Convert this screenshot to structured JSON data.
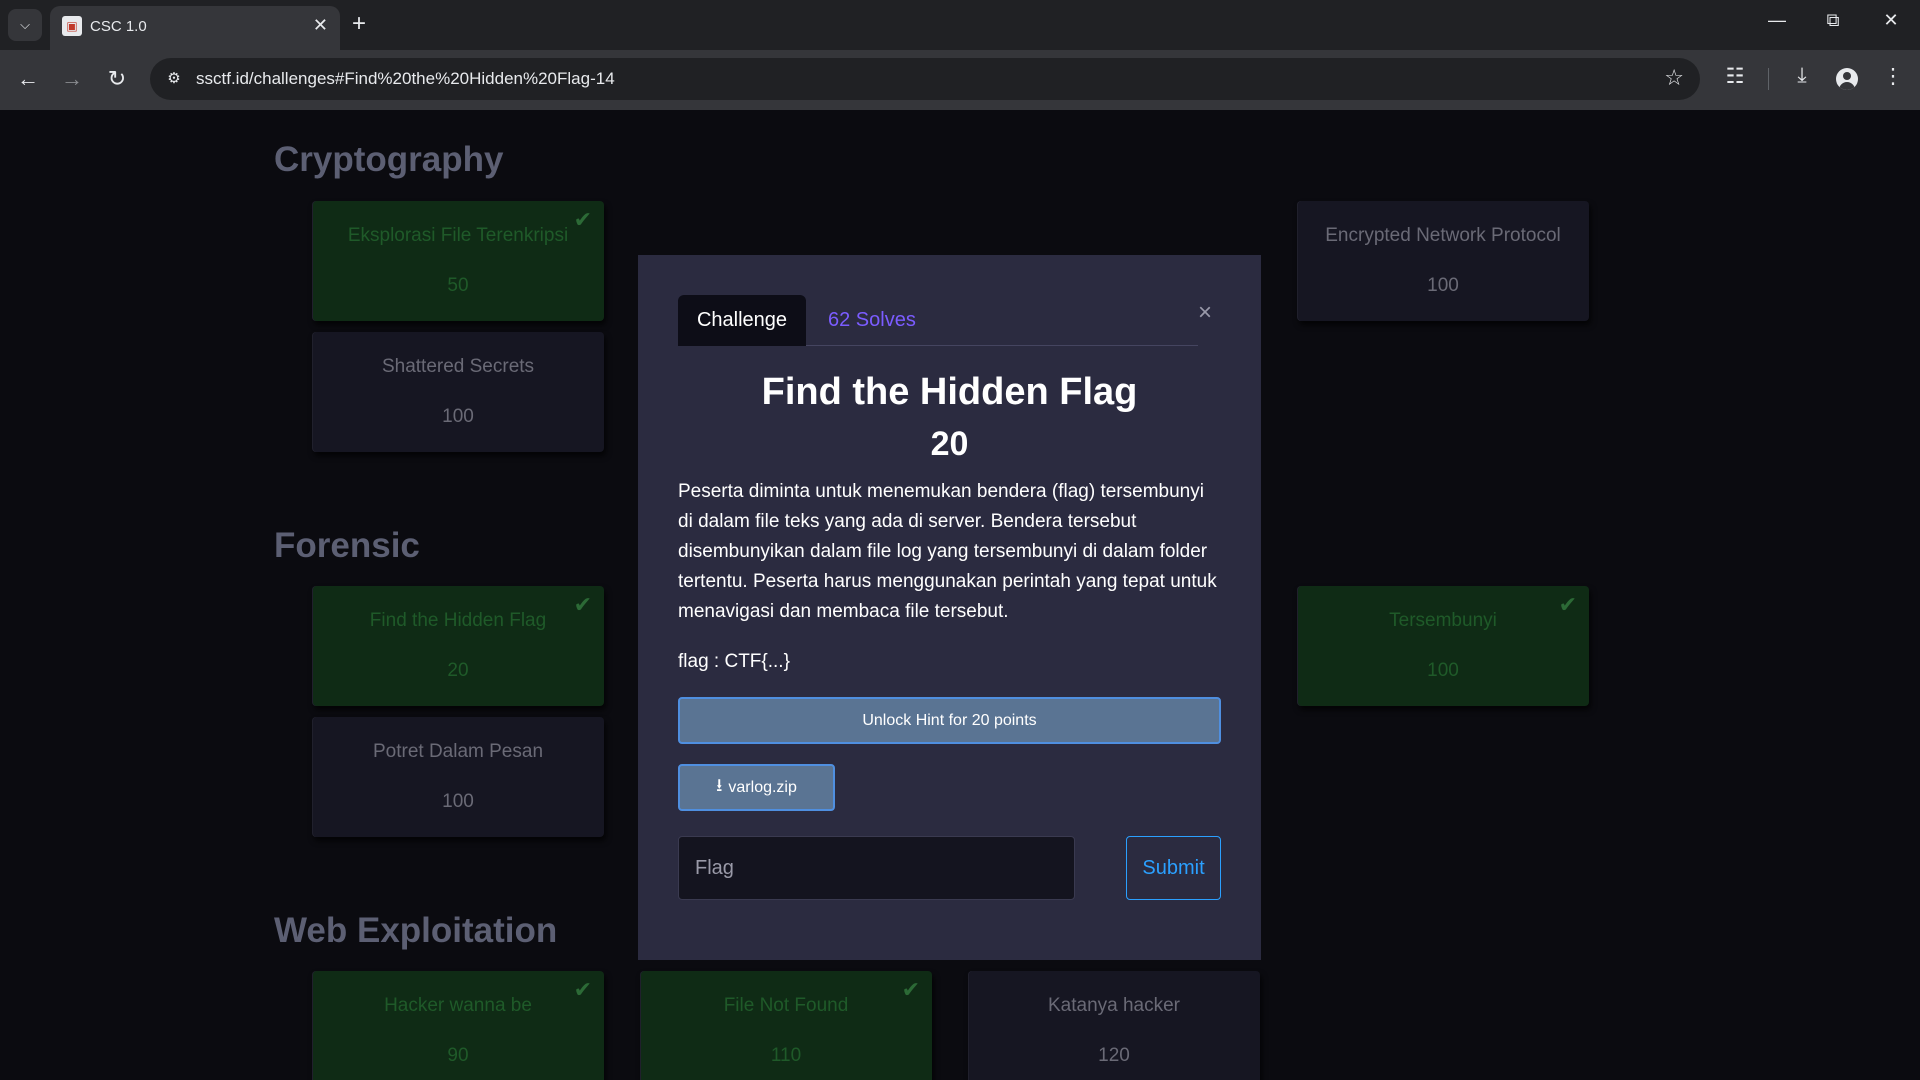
{
  "browser": {
    "tab_title": "CSC 1.0",
    "url": "ssctf.id/challenges#Find%20the%20Hidden%20Flag-14",
    "icons": [
      "tab-search-icon",
      "favicon",
      "close-icon",
      "plus-icon",
      "minimize-icon",
      "restore-icon",
      "close-window-icon",
      "back-icon",
      "forward-icon",
      "reload-icon",
      "site-info-icon",
      "bookmark-star-icon",
      "extensions-icon",
      "download-icon",
      "profile-icon",
      "menu-icon"
    ]
  },
  "categories": [
    {
      "name": "Cryptography",
      "challenges": [
        {
          "name": "Eksplorasi File Terenkripsi",
          "points": "50",
          "solved": true
        },
        {
          "name": "Encrypted Network Protocol",
          "points": "100",
          "solved": false
        },
        {
          "name": "Shattered Secrets",
          "points": "100",
          "solved": false
        }
      ]
    },
    {
      "name": "Forensic",
      "challenges": [
        {
          "name": "Find the Hidden Flag",
          "points": "20",
          "solved": true
        },
        {
          "name": "Tersembunyi",
          "points": "100",
          "solved": true
        },
        {
          "name": "Potret Dalam Pesan",
          "points": "100",
          "solved": false
        }
      ]
    },
    {
      "name": "Web Exploitation",
      "challenges": [
        {
          "name": "Hacker wanna be",
          "points": "90",
          "solved": true
        },
        {
          "name": "File Not Found",
          "points": "110",
          "solved": true
        },
        {
          "name": "Katanya hacker",
          "points": "120",
          "solved": false
        }
      ]
    }
  ],
  "modal": {
    "tab_challenge": "Challenge",
    "tab_solves": "62 Solves",
    "close": "×",
    "title": "Find the Hidden Flag",
    "points": "20",
    "description": "Peserta diminta untuk menemukan bendera (flag) tersembunyi di dalam file teks yang ada di server. Bendera tersebut disembunyikan dalam file log yang tersembunyi di dalam folder tertentu. Peserta harus menggunakan perintah yang tepat untuk menavigasi dan membaca file tersebut.",
    "flag_format": "flag : CTF{...}",
    "hint_button": "Unlock Hint for 20 points",
    "download_file": "varlog.zip",
    "flag_placeholder": "Flag",
    "submit": "Submit"
  },
  "colors": {
    "solved_card": "#0f2b15",
    "unsolved_card": "#161622",
    "modal_bg": "#2b2b40",
    "accent_purple": "#7b5cff",
    "submit_blue": "#2ba0ff"
  }
}
